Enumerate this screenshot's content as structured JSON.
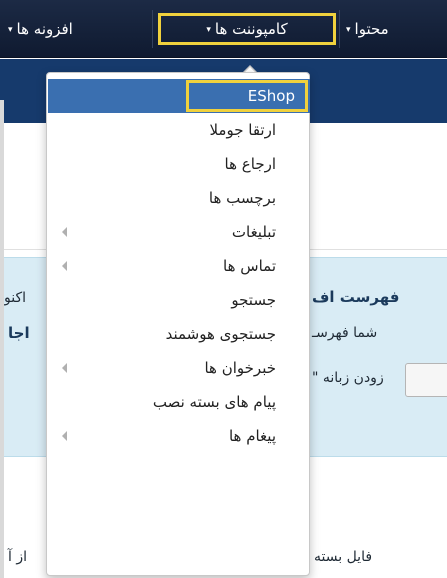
{
  "navbar": {
    "addons_label": "افزونه ها",
    "components_label": "کامپوننت ها",
    "content_label": "محتوا",
    "caret": "▾"
  },
  "background": {
    "panel_title_partial": "فهرست اف",
    "panel_title_left_partial": "اکنو",
    "panel_subtext_partial": "شما فهرسـ",
    "panel_subtext_left_partial": "اجا",
    "add_tab_partial": "زودن زبانه \"",
    "file_label_partial": "فایل بسته",
    "left_text_partial": "از آ"
  },
  "dropdown": {
    "items": [
      {
        "label": "EShop",
        "active": true,
        "submenu": false
      },
      {
        "label": "ارتقا جوملا",
        "active": false,
        "submenu": false
      },
      {
        "label": "ارجاع ها",
        "active": false,
        "submenu": false
      },
      {
        "label": "برچسب ها",
        "active": false,
        "submenu": false
      },
      {
        "label": "تبلیغات",
        "active": false,
        "submenu": true
      },
      {
        "label": "تماس ها",
        "active": false,
        "submenu": true
      },
      {
        "label": "جستجو",
        "active": false,
        "submenu": false
      },
      {
        "label": "جستجوی هوشمند",
        "active": false,
        "submenu": false
      },
      {
        "label": "خبرخوان ها",
        "active": false,
        "submenu": true
      },
      {
        "label": "پیام های بسته نصب",
        "active": false,
        "submenu": false
      },
      {
        "label": "پیغام ها",
        "active": false,
        "submenu": true
      }
    ]
  },
  "colors": {
    "navbar": "#1c2a45",
    "highlight_border": "#f0d13d",
    "active_item": "#3a6fb0",
    "info_panel": "#d9ecf5"
  }
}
